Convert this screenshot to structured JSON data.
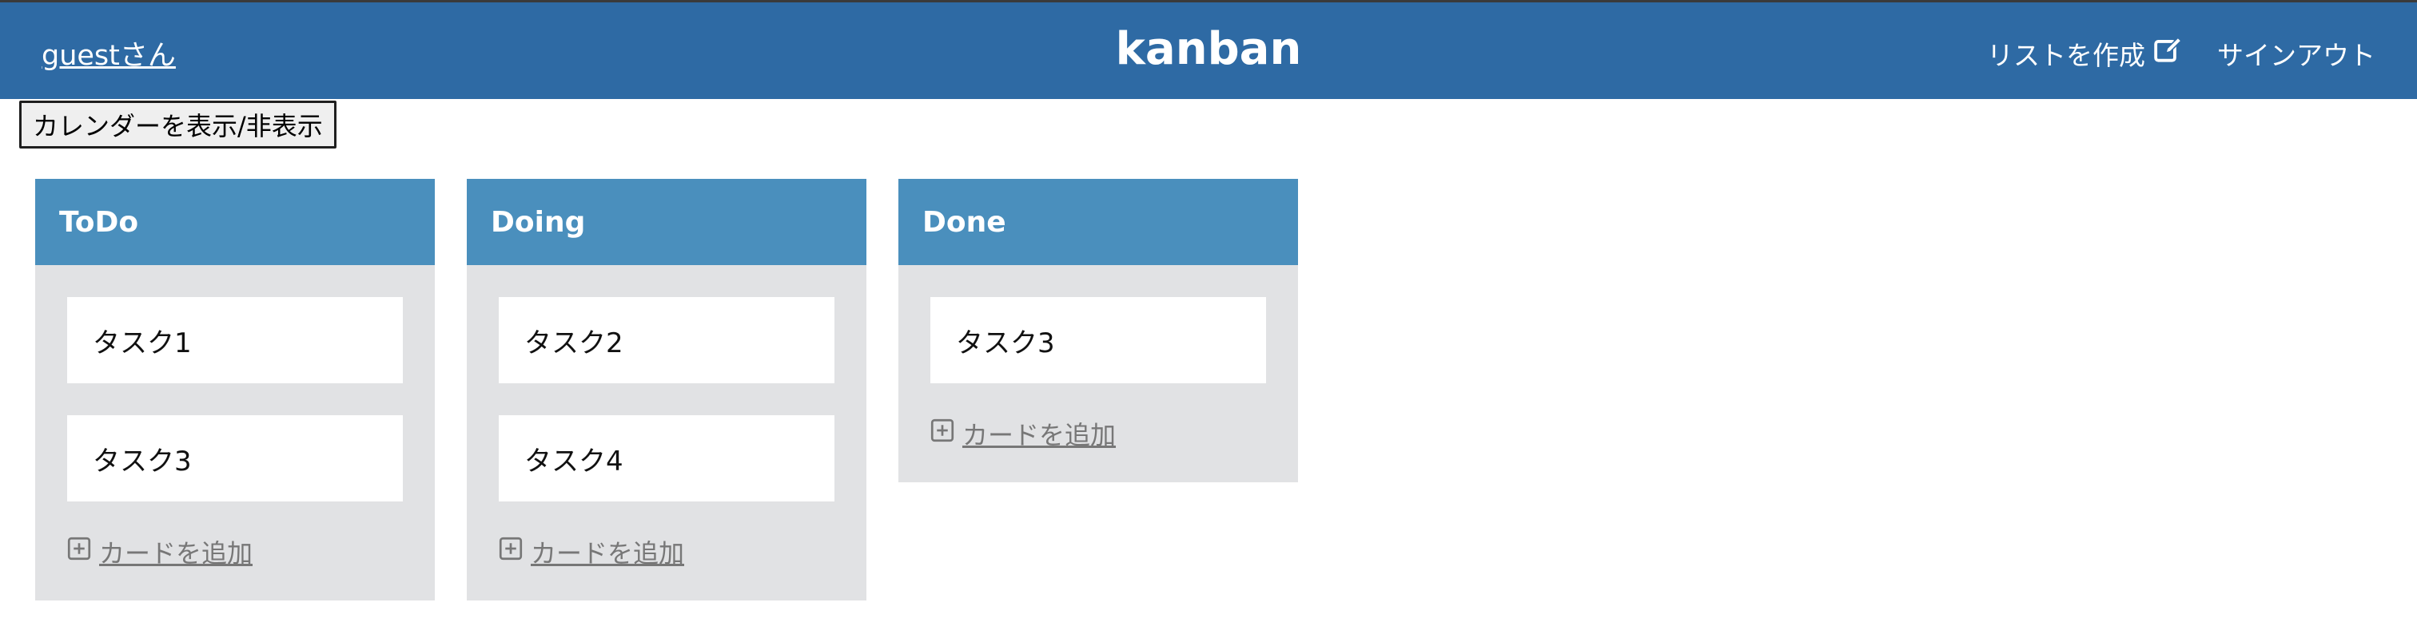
{
  "header": {
    "user_label": "guestさん",
    "title": "kanban",
    "create_list_label": "リストを作成",
    "create_list_icon": "edit-icon",
    "signout_label": "サインアウト",
    "background_color": "#2e6aa4"
  },
  "calendar_toggle_label": "カレンダーを表示/非表示",
  "lists": [
    {
      "title": "ToDo",
      "cards": [
        "タスク1",
        "タスク3"
      ],
      "add_card_label": "カードを追加"
    },
    {
      "title": "Doing",
      "cards": [
        "タスク2",
        "タスク4"
      ],
      "add_card_label": "カードを追加"
    },
    {
      "title": "Done",
      "cards": [
        "タスク3"
      ],
      "add_card_label": "カードを追加"
    }
  ],
  "colors": {
    "list_header": "#4a8fbd",
    "list_body": "#e1e2e4",
    "card": "#ffffff",
    "add_card_text": "#777777"
  },
  "icons": {
    "add_card": "plus-square-icon"
  }
}
